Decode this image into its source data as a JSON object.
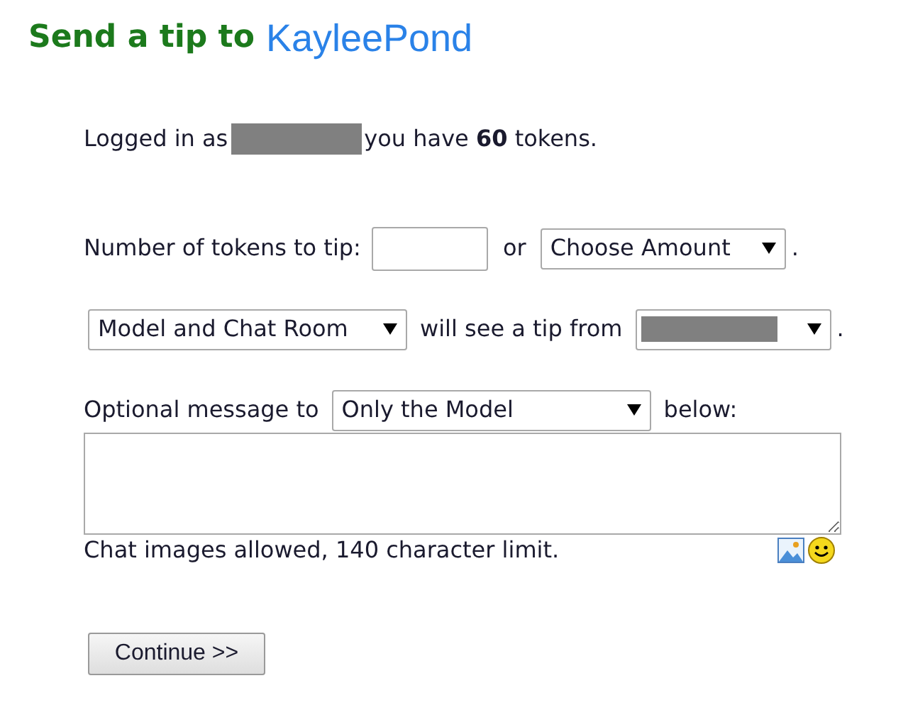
{
  "heading": {
    "prefix": "Send a tip to",
    "model_name": "KayleePond"
  },
  "login": {
    "before": "Logged in as",
    "after": "you have **60** tokens."
  },
  "amount_row": {
    "label": "Number of tokens to tip:",
    "joiner": "or",
    "dropdown": "Choose Amount",
    "end": "."
  },
  "visibility_row": {
    "dropdown": "Model and Chat Room",
    "middle": "will see a tip from",
    "end": "."
  },
  "message": {
    "label": "Optional message to",
    "dropdown": "Only the Model",
    "after": "below:",
    "note": "Chat images allowed, 140 character limit."
  },
  "button": "Continue >>"
}
